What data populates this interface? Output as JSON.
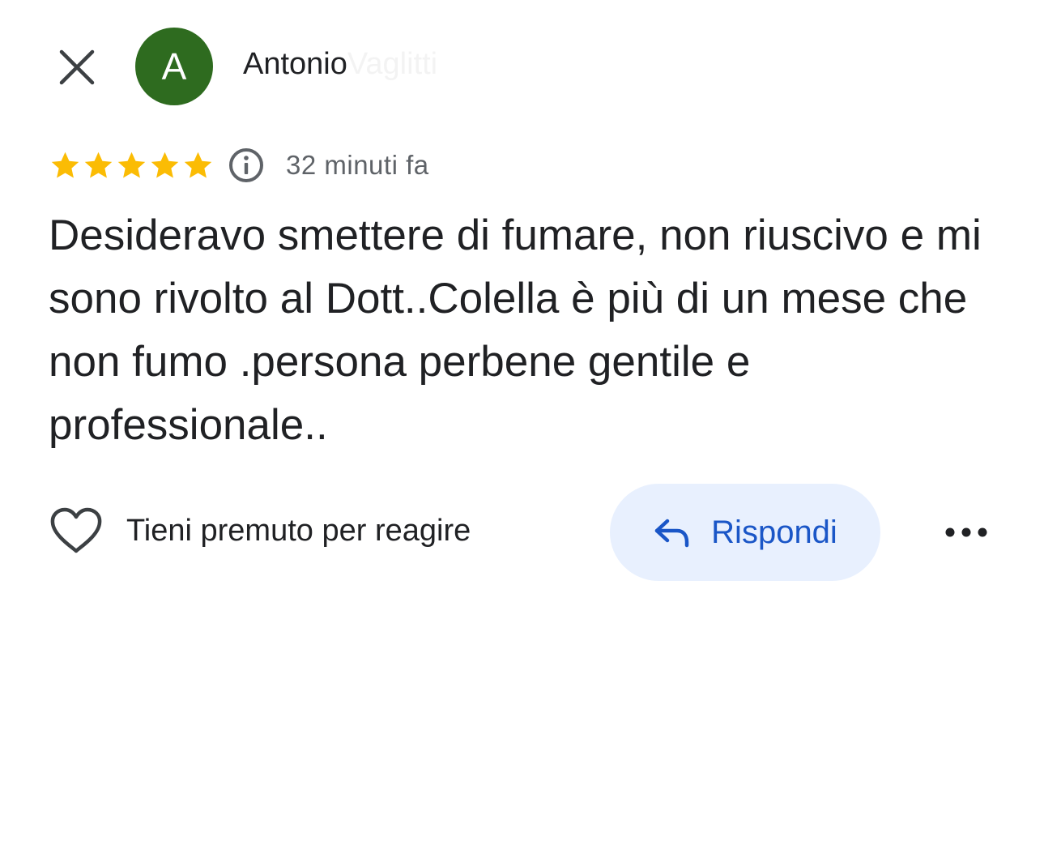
{
  "header": {
    "close_icon": "close-icon",
    "avatar_letter": "A",
    "avatar_color": "#2e6b1f",
    "author_name_visible": "Antonio",
    "author_name_faded": "Vaglitti"
  },
  "review": {
    "rating": 5,
    "rating_max": 5,
    "star_color": "#fbbc04",
    "info_icon": "info-icon",
    "time_ago": "32 minuti fa",
    "text": "Desideravo smettere di fumare, non riuscivo e mi sono rivolto al Dott..Colella è più di un mese che non fumo .persona perbene gentile e professionale.."
  },
  "actions": {
    "like_icon": "heart-icon",
    "like_label": "Tieni premuto per reagire",
    "reply_icon": "reply-arrow-icon",
    "reply_label": "Rispondi",
    "reply_color": "#1a56c7",
    "reply_bg": "#e8f0fe",
    "more_icon": "more-horizontal-icon"
  }
}
